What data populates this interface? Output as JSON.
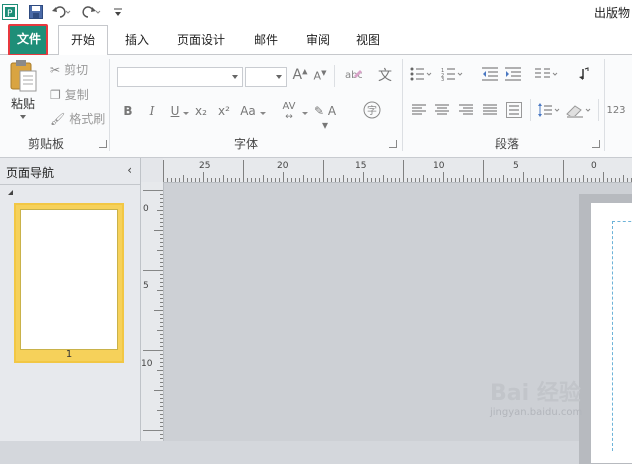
{
  "app": {
    "title": "出版物"
  },
  "qat": {
    "undo_icon": "undo-icon",
    "redo_icon": "redo-icon",
    "save_icon": "save-icon"
  },
  "tabs": [
    {
      "label": "文件"
    },
    {
      "label": "开始"
    },
    {
      "label": "插入"
    },
    {
      "label": "页面设计"
    },
    {
      "label": "邮件"
    },
    {
      "label": "审阅"
    },
    {
      "label": "视图"
    }
  ],
  "clipboard": {
    "paste": "粘贴",
    "cut": "剪切",
    "copy": "复制",
    "format_painter": "格式刷",
    "label": "剪贴板"
  },
  "font": {
    "label": "字体",
    "bold": "B",
    "italic": "I",
    "underline": "U",
    "subscript": "x₂",
    "superscript": "x²",
    "change_case": "Aa",
    "spacing": "AV",
    "grow": "A",
    "shrink": "A",
    "phonetic": "文"
  },
  "paragraph": {
    "label": "段落"
  },
  "styles_partial": {
    "label": "123"
  },
  "nav": {
    "title": "页面导航",
    "close": "‹",
    "page_number": "1"
  },
  "hruler": {
    "labels": [
      "25",
      "20",
      "15",
      "10",
      "5",
      "0"
    ]
  },
  "vruler": {
    "labels": [
      "0",
      "5",
      "10"
    ]
  },
  "watermark": {
    "logo": "Bai 经验",
    "url": "jingyan.baidu.com"
  },
  "colors": {
    "file_tab": "#1e8e78",
    "highlight": "#e8393f",
    "thumb_border": "#f2c744"
  }
}
